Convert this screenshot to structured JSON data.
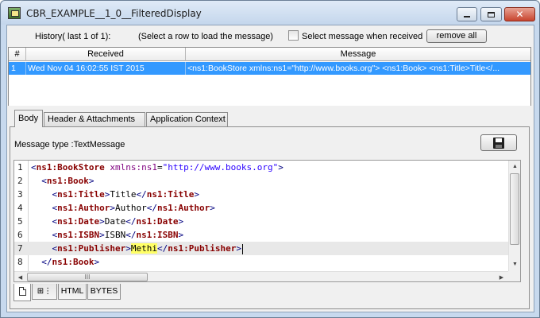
{
  "window": {
    "title": "CBR_EXAMPLE__1_0__FilteredDisplay",
    "controls": {
      "minimize": "minimize",
      "maximize": "maximize",
      "close": "close"
    }
  },
  "history": {
    "label": "History( last 1 of 1):",
    "hint": "(Select a row to load the message)",
    "checkbox_label": "Select message when received",
    "checkbox_checked": false,
    "remove_all": "remove all"
  },
  "table": {
    "columns": [
      "#",
      "Received",
      "Message"
    ],
    "rows": [
      {
        "num": "1",
        "received": "Wed Nov 04 16:02:55 IST 2015",
        "message": "<ns1:BookStore xmlns:ns1=\"http://www.books.org\">    <ns1:Book>      <ns1:Title>Title</..."
      }
    ],
    "selected_row": 0,
    "selection_color": "#3399ff"
  },
  "tabs": [
    {
      "label": "Body",
      "active": true
    },
    {
      "label": "Header & Attachments",
      "active": false
    },
    {
      "label": "Application Context",
      "active": false
    }
  ],
  "body": {
    "message_type": "Message type :TextMessage",
    "save_icon": "floppy-disk-icon",
    "current_line": 7,
    "lines": [
      {
        "n": "1",
        "indent": "",
        "open": "ns1:BookStore",
        "attr": "xmlns:ns1",
        "attr_value": "\"http://www.books.org\"",
        "text": "",
        "close": ""
      },
      {
        "n": "2",
        "indent": "  ",
        "open": "ns1:Book",
        "attr": "",
        "attr_value": "",
        "text": "",
        "close": ""
      },
      {
        "n": "3",
        "indent": "    ",
        "open": "ns1:Title",
        "attr": "",
        "attr_value": "",
        "text": "Title",
        "close": "ns1:Title"
      },
      {
        "n": "4",
        "indent": "    ",
        "open": "ns1:Author",
        "attr": "",
        "attr_value": "",
        "text": "Author",
        "close": "ns1:Author"
      },
      {
        "n": "5",
        "indent": "    ",
        "open": "ns1:Date",
        "attr": "",
        "attr_value": "",
        "text": "Date",
        "close": "ns1:Date"
      },
      {
        "n": "6",
        "indent": "    ",
        "open": "ns1:ISBN",
        "attr": "",
        "attr_value": "",
        "text": "ISBN",
        "close": "ns1:ISBN"
      },
      {
        "n": "7",
        "indent": "    ",
        "open": "ns1:Publisher",
        "attr": "",
        "attr_value": "",
        "text": "Methi",
        "close": "ns1:Publisher"
      },
      {
        "n": "8",
        "indent": "  ",
        "open": "",
        "attr": "",
        "attr_value": "",
        "text": "",
        "close": "ns1:Book"
      }
    ],
    "hscroll_grip": "III",
    "view_tabs": [
      {
        "label": "",
        "icon": "document-icon",
        "active": true
      },
      {
        "label": "",
        "icon": "tree-view-icon",
        "active": false
      },
      {
        "label": "HTML",
        "icon": "",
        "active": false
      },
      {
        "label": "BYTES",
        "icon": "",
        "active": false
      }
    ]
  }
}
